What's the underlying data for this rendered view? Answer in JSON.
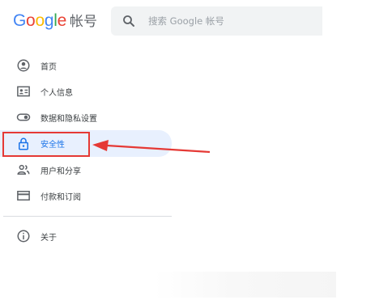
{
  "header": {
    "logo_text": "Google",
    "logo_suffix": "帐号",
    "logo_colors": [
      "#4285F4",
      "#EA4335",
      "#FBBC05",
      "#4285F4",
      "#34A853",
      "#EA4335"
    ]
  },
  "search": {
    "icon": "search-icon",
    "placeholder": "搜索 Google 帐号"
  },
  "nav": {
    "items": [
      {
        "label": "首页",
        "icon": "home-icon"
      },
      {
        "label": "个人信息",
        "icon": "id-card-icon"
      },
      {
        "label": "数据和隐私设置",
        "icon": "toggle-icon"
      },
      {
        "label": "安全性",
        "icon": "lock-icon",
        "active": true
      },
      {
        "label": "用户和分享",
        "icon": "people-icon"
      },
      {
        "label": "付款和订阅",
        "icon": "credit-card-icon"
      }
    ],
    "about": {
      "label": "关于",
      "icon": "info-icon"
    }
  },
  "annotation": {
    "highlight_color": "#e53935"
  }
}
